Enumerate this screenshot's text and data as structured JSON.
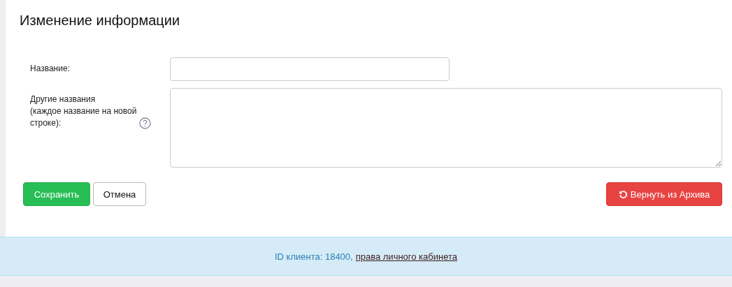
{
  "title": "Изменение информации",
  "fields": [
    {
      "kind": "input",
      "label": "Название:"
    },
    {
      "kind": "textarea",
      "label": "Другие названия\n(каждое название на новой\nстроке):",
      "help": true
    }
  ],
  "buttons": [
    {
      "kind": "save",
      "label": "Сохранить"
    },
    {
      "kind": "cancel",
      "label": "Отмена"
    },
    {
      "kind": "restore",
      "label": "Вернуть из Архива"
    }
  ],
  "footer": {
    "text": "ID клиента: 18400,",
    "link": "права личного кабинета"
  }
}
